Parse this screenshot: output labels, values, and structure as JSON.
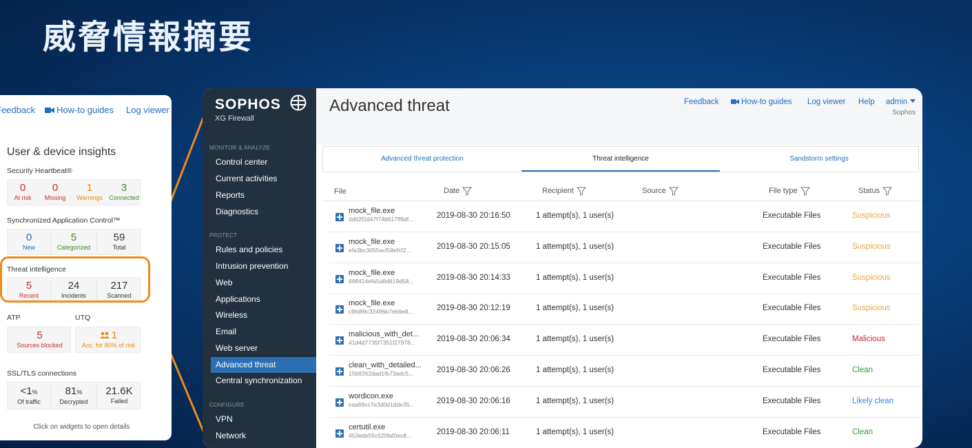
{
  "slide": {
    "title": "威脅情報摘要"
  },
  "widgets": {
    "links": {
      "feedback": "Feedback",
      "howto": "How-to guides",
      "logviewer": "Log viewer"
    },
    "title": "User & device insights",
    "heartbeat": {
      "label": "Security Heartbeat®",
      "items": [
        {
          "value": "0",
          "caption": "At risk",
          "color": "red"
        },
        {
          "value": "0",
          "caption": "Missing",
          "color": "red"
        },
        {
          "value": "1",
          "caption": "Warnings",
          "color": "orange"
        },
        {
          "value": "3",
          "caption": "Connected",
          "color": "green"
        }
      ]
    },
    "appcontrol": {
      "label": "Synchronized Application Control™",
      "items": [
        {
          "value": "0",
          "caption": "New",
          "color": "blue"
        },
        {
          "value": "5",
          "caption": "Categorized",
          "color": "green"
        },
        {
          "value": "59",
          "caption": "Total",
          "color": "dark"
        }
      ]
    },
    "threat_intel": {
      "label": "Threat intelligence",
      "items": [
        {
          "value": "5",
          "caption": "Recent",
          "color": "red"
        },
        {
          "value": "24",
          "caption": "Incidents",
          "color": "dark"
        },
        {
          "value": "217",
          "caption": "Scanned",
          "color": "dark"
        }
      ]
    },
    "atp": {
      "label": "ATP",
      "value": "5",
      "caption": "Sources blocked"
    },
    "utq": {
      "label": "UTQ",
      "value": "1",
      "caption": "Acc. for 80% of risk"
    },
    "ssl": {
      "label": "SSL/TLS connections",
      "items": [
        {
          "value": "<1",
          "unit": "%",
          "caption": "Of traffic"
        },
        {
          "value": "81",
          "unit": "%",
          "caption": "Decrypted"
        },
        {
          "value": "21.6K",
          "unit": "",
          "caption": "Failed"
        }
      ]
    },
    "footer": "Click on widgets to open details"
  },
  "app": {
    "brand": {
      "name": "SOPHOS",
      "product": "XG Firewall"
    },
    "sidebar": {
      "sections": [
        {
          "label": "MONITOR & ANALYZE",
          "items": [
            "Control center",
            "Current activities",
            "Reports",
            "Diagnostics"
          ]
        },
        {
          "label": "PROTECT",
          "items": [
            "Rules and policies",
            "Intrusion prevention",
            "Web",
            "Applications",
            "Wireless",
            "Email",
            "Web server",
            "Advanced threat",
            "Central synchronization"
          ]
        },
        {
          "label": "CONFIGURE",
          "items": [
            "VPN",
            "Network"
          ]
        }
      ],
      "active": "Advanced threat"
    },
    "header": {
      "title": "Advanced threat",
      "links": {
        "feedback": "Feedback",
        "howto": "How-to guides",
        "logviewer": "Log viewer",
        "help": "Help",
        "admin": "admin"
      },
      "org": "Sophos"
    },
    "tabs": [
      "Advanced threat protection",
      "Threat intelligence",
      "Sandstorm settings"
    ],
    "active_tab": "Threat intelligence",
    "table": {
      "columns": [
        "File",
        "Date",
        "Recipient",
        "Source",
        "File type",
        "Status"
      ],
      "rows": [
        {
          "file": "mock_file.exe",
          "hash": "4d02f2d47f74b617ff8df...",
          "date": "2019-08-30 20:16:50",
          "recipient": "1 attempt(s), 1 user(s)",
          "type": "Executable Files",
          "status": "Suspicious",
          "status_class": "st-suspicious"
        },
        {
          "file": "mock_file.exe",
          "hash": "efa3bc3055acf58efcf2...",
          "date": "2019-08-30 20:15:05",
          "recipient": "1 attempt(s), 1 user(s)",
          "type": "Executable Files",
          "status": "Suspicious",
          "status_class": "st-suspicious"
        },
        {
          "file": "mock_file.exe",
          "hash": "66ff414efa5a8d819d58...",
          "date": "2019-08-30 20:14:33",
          "recipient": "1 attempt(s), 1 user(s)",
          "type": "Executable Files",
          "status": "Suspicious",
          "status_class": "st-suspicious"
        },
        {
          "file": "mock_file.exe",
          "hash": "c9fd89c32496b7eb9e8...",
          "date": "2019-08-30 20:12:19",
          "recipient": "1 attempt(s), 1 user(s)",
          "type": "Executable Files",
          "status": "Suspicious",
          "status_class": "st-suspicious"
        },
        {
          "file": "malicious_with_det...",
          "hash": "41d4d7735f7351f27978...",
          "date": "2019-08-30 20:06:34",
          "recipient": "1 attempt(s), 1 user(s)",
          "type": "Executable Files",
          "status": "Malicious",
          "status_class": "st-malicious"
        },
        {
          "file": "clean_with_detailed...",
          "hash": "15b9262dad1fb73adc5...",
          "date": "2019-08-30 20:06:26",
          "recipient": "1 attempt(s), 1 user(s)",
          "type": "Executable Files",
          "status": "Clean",
          "status_class": "st-clean"
        },
        {
          "file": "wordicon.exe",
          "hash": "caa69cc7e3d0d1dde35...",
          "date": "2019-08-30 20:06:16",
          "recipient": "1 attempt(s), 1 user(s)",
          "type": "Executable Files",
          "status": "Likely clean",
          "status_class": "st-likely"
        },
        {
          "file": "certutil.exe",
          "hash": "453ede55c520faf0ec8...",
          "date": "2019-08-30 20:06:11",
          "recipient": "1 attempt(s), 1 user(s)",
          "type": "Executable Files",
          "status": "Clean",
          "status_class": "st-clean"
        }
      ]
    }
  },
  "colors": {
    "accent": "#2d6fb3",
    "highlight": "#f08a1c",
    "sidebar": "#22313f"
  }
}
